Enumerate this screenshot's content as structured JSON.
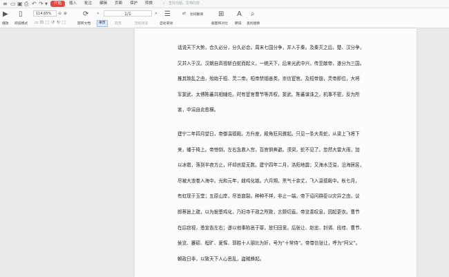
{
  "quick_access": {
    "icons": [
      "menu-icon",
      "open-file-icon",
      "save-icon",
      "print-icon",
      "undo-icon",
      "redo-icon",
      "more-icon"
    ]
  },
  "menu": {
    "items": [
      "开始",
      "插入",
      "批注",
      "编辑",
      "页面",
      "保护",
      "转换"
    ],
    "active_index": 0
  },
  "search_hint": "查找功能、文档内容",
  "toolbar": {
    "play_label": "播放",
    "read_mode_label": "阅读模式",
    "zoom_value": "114.65%",
    "rotate_label": "旋转文档",
    "page_display": "1/1",
    "single_page_label": "单页",
    "dual_page_label": "双页",
    "continuous_label": "连续阅读",
    "auto_scroll_label": "自动滚动",
    "translate_label": "划词翻译",
    "screenshot_label": "截图和对比",
    "read_aloud_label": "朗读",
    "find_replace_label": "查找替换"
  },
  "document": {
    "paragraphs": [
      [
        "话说天下大势，合久必分，分久必合。周末七国分争，并入于秦。及秦灭之后，楚、汉分争，",
        "又并入于汉。汉朝自高祖斩白蛇而起义，一统天下，后来光武中兴，传至献帝，遂分为三国。",
        "推其致乱之由，殆始于桓、灵二帝。桓帝禁锢善类，崇信宦官。及桓帝崩，灵帝即位，大将",
        "军窦武、太傅陈蕃共相辅佐。时有宦官曹节等弄权，窦武、陈蕃谋诛之，机事不密，反为所",
        "害，中涓自此愈横。"
      ],
      [
        "建宁二年四月望日，帝御温德殿。方升座，殿角狂风骤起。只见一条大青蛇，从梁上飞将下",
        "来，蟠于椅上。帝惊倒，左右急救入宫，百官俱奔避。须臾，蛇不见了。忽然大雷大雨，加",
        "以冰雹，落到半夜方止，坏却房屋无数。建宁四年二月，洛阳地震；又海水泛溢，沿海居民，",
        "尽被大浪卷入海中。光和元年，雌鸡化雄。六月朔，黑气十余丈，飞入温德殿中。秋七月，",
        "有虹现于玉堂；五原山岸，尽皆崩裂。种种不祥，非止一端。帝下诏问群臣以灾异之由，议",
        "郎蔡邕上疏，以为蜺堕鸡化，乃妇寺干政之所致，言颇切直。帝览奏叹息，因起更衣。曹节",
        "在后窃视，悉宣告左右；遂以他事陷邕于罪，放归田里。后张让、赵忠、封谞、段珪、曹节、",
        "侯览、蹇硕、程旷、夏恽、郭胜十人朋比为奸，号为“十常侍”。帝尊信张让，呼为“阿父”。",
        "朝政日非，以致天下人心思乱，盗贼蜂起。"
      ]
    ]
  }
}
